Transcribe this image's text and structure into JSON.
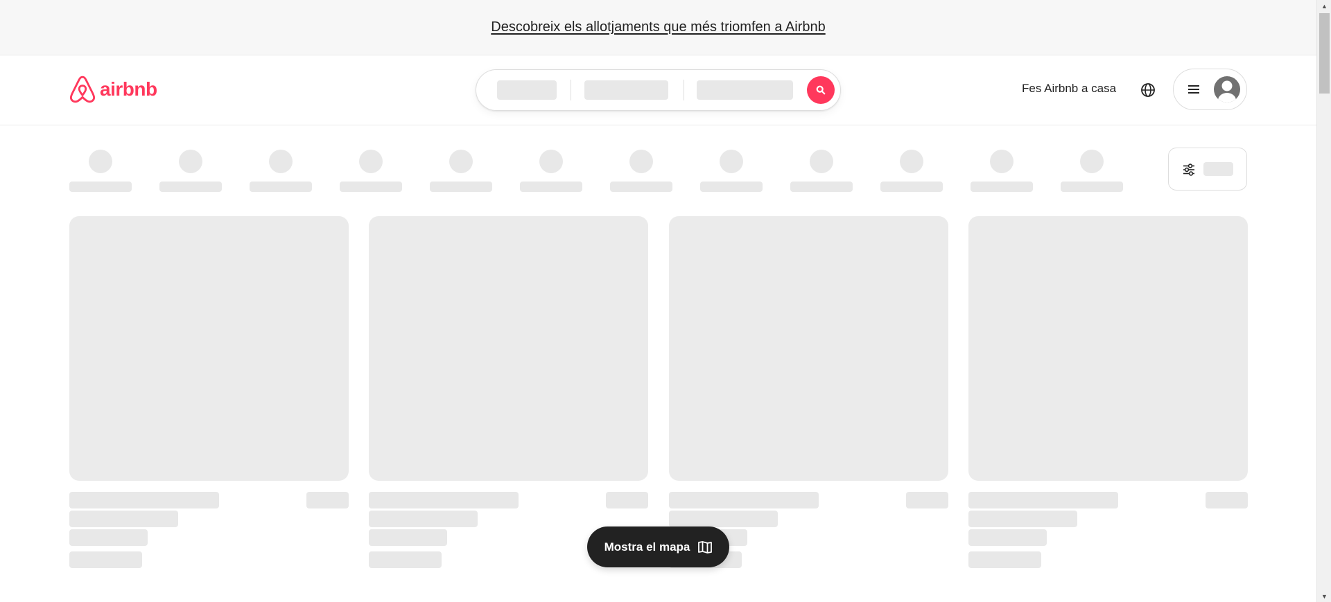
{
  "banner": {
    "link_text": "Descobreix els allotjaments que més triomfen a Airbnb"
  },
  "header": {
    "logo_text": "airbnb",
    "host_link": "Fes Airbnb a casa"
  },
  "map_button": {
    "label": "Mostra el mapa"
  },
  "colors": {
    "brand": "#ff385c",
    "skeleton": "#e8e8e8",
    "dark_button": "#222222"
  },
  "icons": [
    "airbnb-logo-icon",
    "search-icon",
    "globe-icon",
    "menu-icon",
    "avatar-icon",
    "filters-icon",
    "map-icon"
  ]
}
